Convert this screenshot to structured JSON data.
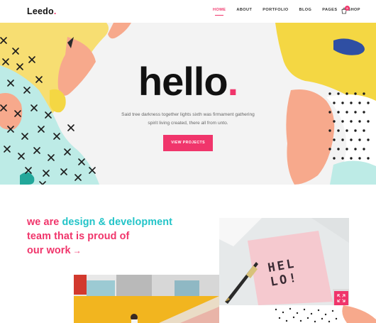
{
  "brand": {
    "name": "Leedo",
    "dot": "."
  },
  "nav": {
    "items": [
      {
        "label": "HOME",
        "active": true
      },
      {
        "label": "ABOUT",
        "active": false
      },
      {
        "label": "PORTFOLIO",
        "active": false
      },
      {
        "label": "BLOG",
        "active": false
      },
      {
        "label": "PAGES",
        "active": false
      },
      {
        "label": "SHOP",
        "active": false
      }
    ],
    "cart_icon": "shopping-bag-icon",
    "cart_count": "0"
  },
  "hero": {
    "title": "hello",
    "title_dot": ".",
    "description": "Said tree darkness together lights sixth was firmament gathering spirit living created, there all from unto.",
    "button_label": "VIEW PROJECTS"
  },
  "about": {
    "line1_pink": "we are ",
    "line1_teal": "design & development",
    "line2": "team that is proud of",
    "line3": "our work",
    "arrow": "→"
  },
  "note_card": {
    "text": "HEL LO!"
  },
  "expand_icon": "expand-icon",
  "colors": {
    "accent": "#f0356b",
    "teal": "#22c4c8",
    "yellow": "#f4d743",
    "peach": "#f7a98c",
    "mint": "#bdebe6"
  }
}
